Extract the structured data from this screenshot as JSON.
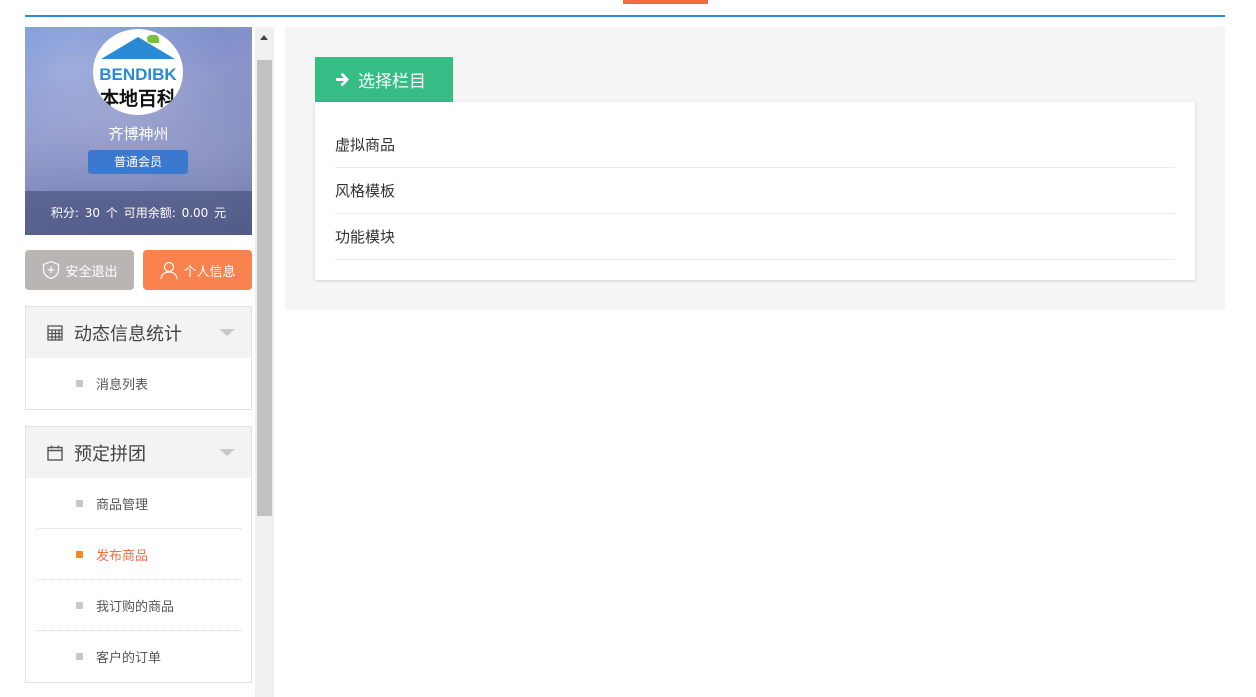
{
  "profile": {
    "logo_text_en": "BENDIBK",
    "logo_text_cn": "本地百科",
    "username": "齐博神州",
    "member_level": "普通会员",
    "points_label": "积分:",
    "points_value": "30",
    "points_unit": "个",
    "balance_label": "可用余额:",
    "balance_value": "0.00",
    "balance_unit": "元"
  },
  "buttons": {
    "logout": "安全退出",
    "profile": "个人信息"
  },
  "menu": {
    "stats": {
      "title": "动态信息统计",
      "items": [
        {
          "label": "消息列表"
        }
      ]
    },
    "groupbuy": {
      "title": "预定拼团",
      "items": [
        {
          "label": "商品管理"
        },
        {
          "label": "发布商品"
        },
        {
          "label": "我订购的商品"
        },
        {
          "label": "客户的订单"
        }
      ]
    }
  },
  "main": {
    "section_title": "选择栏目",
    "categories": [
      {
        "label": "虚拟商品"
      },
      {
        "label": "风格模板"
      },
      {
        "label": "功能模块"
      }
    ]
  },
  "colors": {
    "accent_blue": "#2a8ad6",
    "accent_orange": "#f26d3d",
    "section_green": "#35bd85",
    "profile_button": "#f9824e",
    "logout_button": "#b8b5b3"
  }
}
